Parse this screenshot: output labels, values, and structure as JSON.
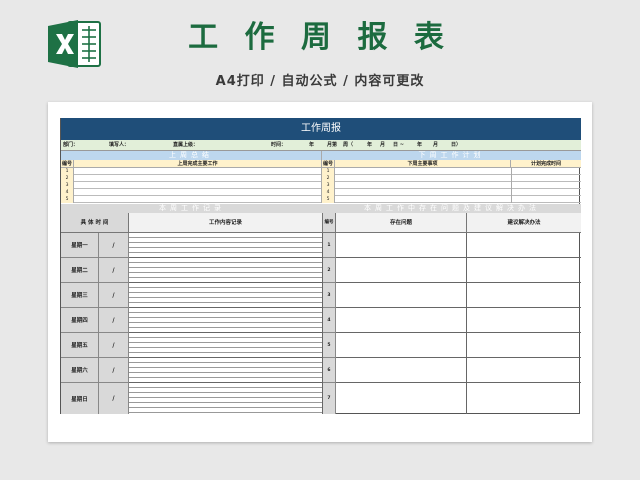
{
  "hero": {
    "title": "工 作 周 报 表",
    "subtitle": "A4打印 / 自动公式 / 内容可更改",
    "logo_icon": "excel-logo-icon",
    "brand_color": "#1c6b3f"
  },
  "sheet": {
    "banner": "工作周报",
    "info": {
      "dept": "部门：",
      "writer": "填写人：",
      "leader": "直属上级：",
      "time": "时间：",
      "year": "年",
      "week": "月第",
      "week_tail": "周（",
      "y2": "年",
      "m2": "月",
      "d2": "日 ~",
      "y3": "年",
      "m3": "月",
      "d3": "日）"
    },
    "last_week": {
      "section": "上周总结",
      "col_no": "编号",
      "col_work": "上周完成主要工作",
      "rows": [
        "1",
        "2",
        "3",
        "4",
        "5"
      ]
    },
    "next_week": {
      "section": "下周工作计划",
      "col_no": "编号",
      "col_item": "下周主要事项",
      "col_time": "计划完成时间",
      "rows": [
        "1",
        "2",
        "3",
        "4",
        "5"
      ]
    },
    "this_week": {
      "section": "本周工作记录",
      "col_time": "具 体 时 间",
      "col_content": "工作内容记录",
      "days": [
        {
          "day": "星期一",
          "slash": "/"
        },
        {
          "day": "星期二",
          "slash": "/"
        },
        {
          "day": "星期三",
          "slash": "/"
        },
        {
          "day": "星期四",
          "slash": "/"
        },
        {
          "day": "星期五",
          "slash": "/"
        },
        {
          "day": "星期六",
          "slash": "/"
        },
        {
          "day": "星期日",
          "slash": "/"
        }
      ]
    },
    "issues": {
      "section": "本周工作中存在问题及建议解决办法",
      "col_no": "编号",
      "col_problem": "存在问题",
      "col_solution": "建议解决办法",
      "rows": [
        "1",
        "2",
        "3",
        "4",
        "5",
        "6",
        "7"
      ]
    },
    "colors": {
      "banner": "#1f4e79",
      "info_bg": "#e2efd9",
      "section_blue": "#bdd7ee",
      "header_yellow": "#fff2cc",
      "gray": "#d9d9d9"
    }
  }
}
